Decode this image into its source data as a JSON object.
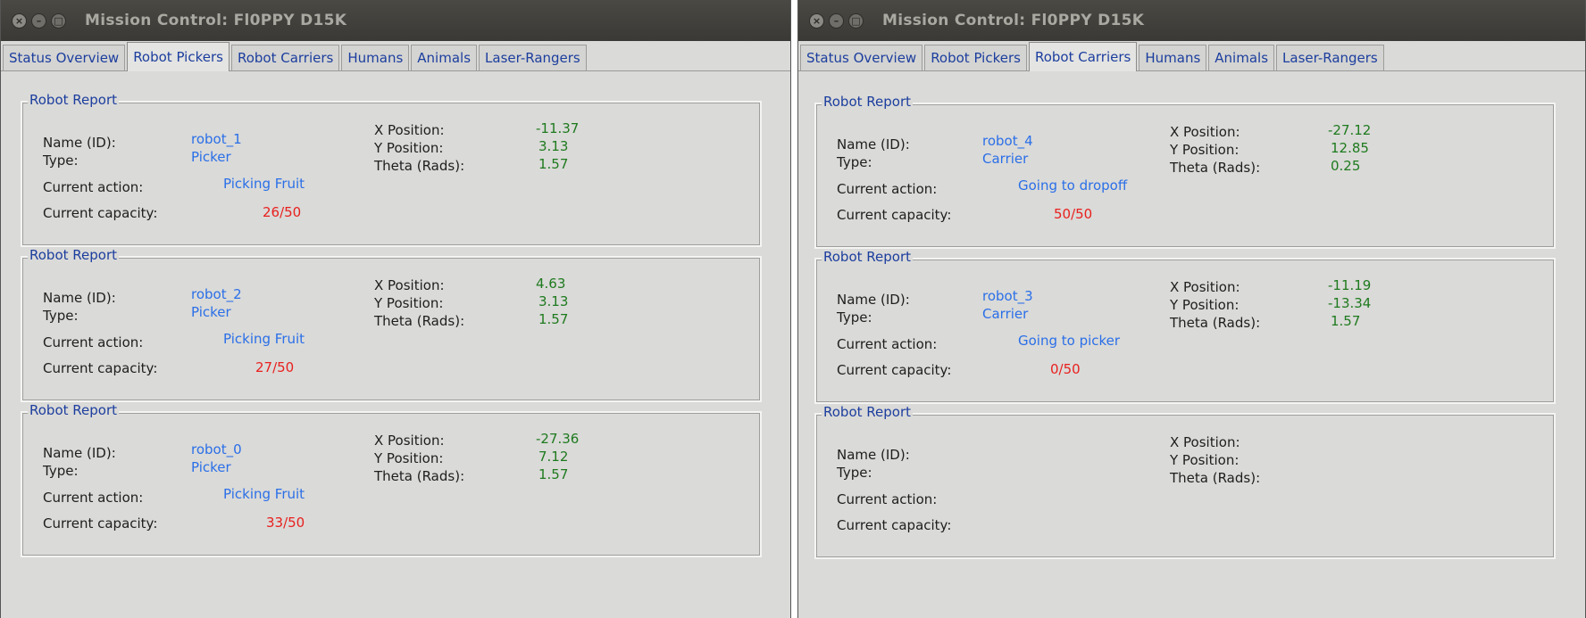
{
  "labels": {
    "name": "Name (ID):",
    "type": "Type:",
    "action": "Current action:",
    "capacity": "Current capacity:",
    "x": "X Position:",
    "y": "Y Position:",
    "theta": "Theta (Rads):",
    "report_title": "Robot Report"
  },
  "colors": {
    "label": "#1e1e1e",
    "tab_text": "#1c3e9e",
    "identity": "#2a6fe8",
    "capacity": "#e8201e",
    "pose": "#1e7a1e"
  },
  "windows": [
    {
      "title": "Mission Control: Fl0PPY D15K",
      "tabs": [
        "Status Overview",
        "Robot Pickers",
        "Robot Carriers",
        "Humans",
        "Animals",
        "Laser-Rangers"
      ],
      "active_tab": "Robot Pickers",
      "reports": [
        {
          "name": "robot_1",
          "type": "Picker",
          "action": "Picking Fruit",
          "capacity": "26/50",
          "x": "-11.37",
          "y": "3.13",
          "theta": "1.57"
        },
        {
          "name": "robot_2",
          "type": "Picker",
          "action": "Picking Fruit",
          "capacity": "27/50",
          "x": "4.63",
          "y": "3.13",
          "theta": "1.57"
        },
        {
          "name": "robot_0",
          "type": "Picker",
          "action": "Picking Fruit",
          "capacity": "33/50",
          "x": "-27.36",
          "y": "7.12",
          "theta": "1.57"
        }
      ]
    },
    {
      "title": "Mission Control: Fl0PPY D15K",
      "tabs": [
        "Status Overview",
        "Robot Pickers",
        "Robot Carriers",
        "Humans",
        "Animals",
        "Laser-Rangers"
      ],
      "active_tab": "Robot Carriers",
      "reports": [
        {
          "name": "robot_4",
          "type": "Carrier",
          "action": "Going to dropoff",
          "capacity": "50/50",
          "x": "-27.12",
          "y": "12.85",
          "theta": "0.25"
        },
        {
          "name": "robot_3",
          "type": "Carrier",
          "action": "Going to picker",
          "capacity": "0/50",
          "x": "-11.19",
          "y": "-13.34",
          "theta": "1.57"
        },
        {
          "name": "",
          "type": "",
          "action": "",
          "capacity": "",
          "x": "",
          "y": "",
          "theta": ""
        }
      ]
    }
  ]
}
